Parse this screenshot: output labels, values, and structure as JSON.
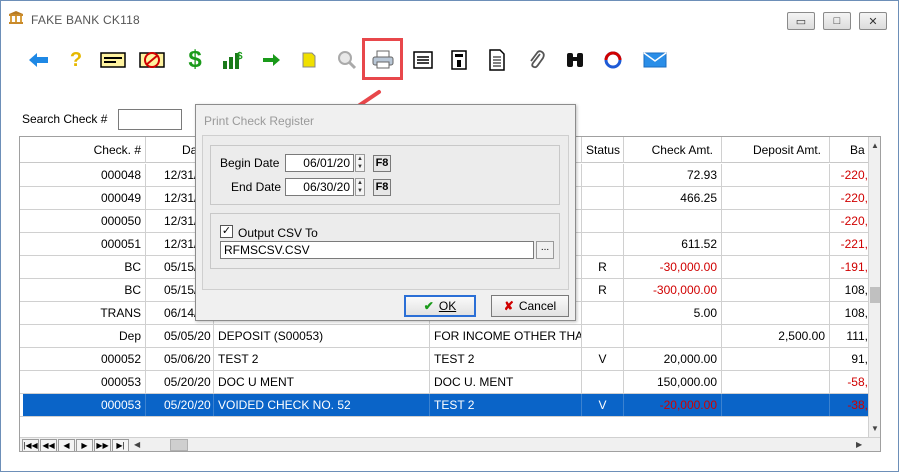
{
  "window": {
    "title": "FAKE BANK  CK118",
    "controls": {
      "minimize": "▭",
      "restore": "□",
      "close": "✕"
    }
  },
  "toolbar": {
    "items": [
      {
        "name": "back-arrow-icon",
        "glyph": "🡄",
        "color": "#1e88e5"
      },
      {
        "name": "help-icon",
        "glyph": "?",
        "color": "#e6b800"
      },
      {
        "name": "check-icon"
      },
      {
        "name": "void-check-icon"
      },
      {
        "name": "dollar-icon",
        "glyph": "$",
        "color": "#1a9a1a"
      },
      {
        "name": "deposit-chart-icon"
      },
      {
        "name": "transfer-arrow-icon",
        "glyph": "➡",
        "color": "#1a9a1a"
      },
      {
        "name": "note-icon"
      },
      {
        "name": "magnifier-icon",
        "glyph": "🔍"
      },
      {
        "name": "printer-icon",
        "glyph": "🖶"
      },
      {
        "name": "list-icon"
      },
      {
        "name": "calculator-icon"
      },
      {
        "name": "document-icon"
      },
      {
        "name": "paperclip-icon",
        "glyph": "📎"
      },
      {
        "name": "binoculars-icon"
      },
      {
        "name": "refresh-icon",
        "glyph": "⟳",
        "color": "#d00000"
      },
      {
        "name": "email-icon",
        "glyph": "✉",
        "color": "#1e88e5"
      }
    ]
  },
  "search": {
    "label": "Search Check #",
    "value": ""
  },
  "grid": {
    "headers": [
      "Check. #",
      "Da",
      "",
      "",
      "Status",
      "Check Amt.",
      "Deposit Amt.",
      "Ba"
    ],
    "rows": [
      {
        "check": "000048",
        "date": "12/31/",
        "payee": "",
        "memo": "",
        "status": "",
        "check_amt": "72.93",
        "deposit_amt": "",
        "balance": "-220,",
        "check_neg": false,
        "bal_neg": true
      },
      {
        "check": "000049",
        "date": "12/31/",
        "payee": "",
        "memo": "",
        "status": "",
        "check_amt": "466.25",
        "deposit_amt": "",
        "balance": "-220,",
        "check_neg": false,
        "bal_neg": true
      },
      {
        "check": "000050",
        "date": "12/31/",
        "payee": "",
        "memo": "",
        "status": "",
        "check_amt": "",
        "deposit_amt": "",
        "balance": "-220,",
        "check_neg": false,
        "bal_neg": true
      },
      {
        "check": "000051",
        "date": "12/31/",
        "payee": "",
        "memo": "",
        "status": "",
        "check_amt": "611.52",
        "deposit_amt": "",
        "balance": "-221,",
        "check_neg": false,
        "bal_neg": true
      },
      {
        "check": "BC",
        "date": "05/15/",
        "payee": "",
        "memo": "",
        "status": "R",
        "check_amt": "-30,000.00",
        "deposit_amt": "",
        "balance": "-191,",
        "check_neg": true,
        "bal_neg": true
      },
      {
        "check": "BC",
        "date": "05/15/",
        "payee": "",
        "memo": "",
        "status": "R",
        "check_amt": "-300,000.00",
        "deposit_amt": "",
        "balance": "108,",
        "check_neg": true,
        "bal_neg": false
      },
      {
        "check": "TRANS",
        "date": "06/14/",
        "payee": "",
        "memo": "",
        "status": "",
        "check_amt": "5.00",
        "deposit_amt": "",
        "balance": "108,",
        "check_neg": false,
        "bal_neg": false
      },
      {
        "check": "Dep",
        "date": "05/05/20",
        "payee": "DEPOSIT (S00053)",
        "memo": "FOR INCOME OTHER THAN",
        "status": "",
        "check_amt": "",
        "deposit_amt": "2,500.00",
        "balance": "111,",
        "check_neg": false,
        "bal_neg": false
      },
      {
        "check": "000052",
        "date": "05/06/20",
        "payee": "TEST 2",
        "memo": "TEST 2",
        "status": "V",
        "check_amt": "20,000.00",
        "deposit_amt": "",
        "balance": "91,",
        "check_neg": false,
        "bal_neg": false
      },
      {
        "check": "000053",
        "date": "05/20/20",
        "payee": "DOC U MENT",
        "memo": "DOC U. MENT",
        "status": "",
        "check_amt": "150,000.00",
        "deposit_amt": "",
        "balance": "-58,",
        "check_neg": false,
        "bal_neg": true
      },
      {
        "check": "000053",
        "date": "05/20/20",
        "payee": "VOIDED CHECK NO.     52",
        "memo": "TEST 2",
        "status": "V",
        "check_amt": "-20,000.00",
        "deposit_amt": "",
        "balance": "-38,",
        "check_neg": true,
        "bal_neg": true,
        "selected": true
      }
    ],
    "nav": [
      "|◀◀",
      "◀◀",
      "◀",
      "▶",
      "▶▶",
      "▶|"
    ]
  },
  "dialog": {
    "title": "Print Check Register",
    "begin_date_label": "Begin Date",
    "begin_date": "06/01/20",
    "end_date_label": "End Date",
    "end_date": "06/30/20",
    "f8_label": "F8",
    "output_csv_label": "Output CSV To",
    "output_csv_checked": true,
    "csv_path": "RFMSCSV.CSV",
    "browse_label": "...",
    "ok_label": "OK",
    "cancel_label": "Cancel"
  },
  "colors": {
    "selection": "#0a64c8",
    "negative": "#d00000",
    "highlight": "#e8474b"
  }
}
